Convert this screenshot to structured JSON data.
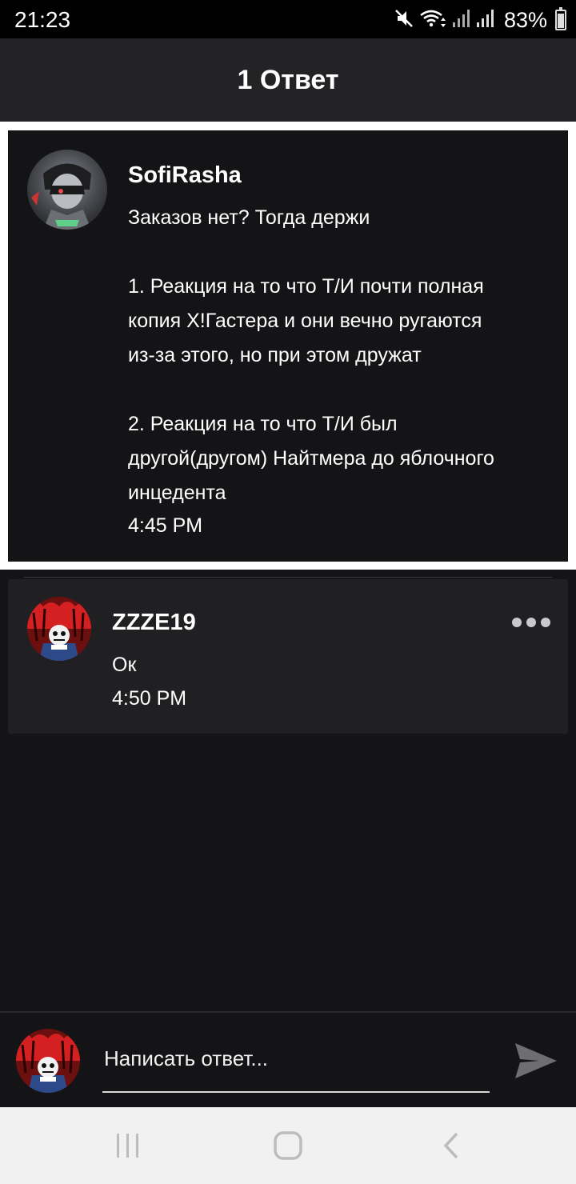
{
  "status_bar": {
    "time": "21:23",
    "battery_percent": "83%",
    "battery_level": 0.83,
    "icons": [
      "mute-icon",
      "wifi-icon",
      "signal-icon",
      "signal-icon"
    ]
  },
  "header": {
    "title": "1 Ответ"
  },
  "parent_comment": {
    "username": "SofiRasha",
    "text": "Заказов нет? Тогда держи\n\n1. Реакция на то что Т/И почти полная\nкопия X!Гастера и они вечно ругаются\nиз-за этого, но при этом дружат\n\n2. Реакция на то что Т/И был\nдругой(другом) Найтмера до яблочного\nинцедента",
    "time": "4:45 PM"
  },
  "reply": {
    "username": "ZZZE19",
    "text": "Ок",
    "time": "4:50 PM",
    "menu_icon": "more-horizontal-icon"
  },
  "compose": {
    "placeholder": "Написать ответ...",
    "send_icon": "send-icon"
  },
  "nav_bar": {
    "icons": [
      "recent-apps-icon",
      "home-icon",
      "back-icon"
    ]
  },
  "colors": {
    "background": "#141316",
    "header": "#232224",
    "reply_card": "#201f22",
    "highlight_border": "#ffffff"
  }
}
